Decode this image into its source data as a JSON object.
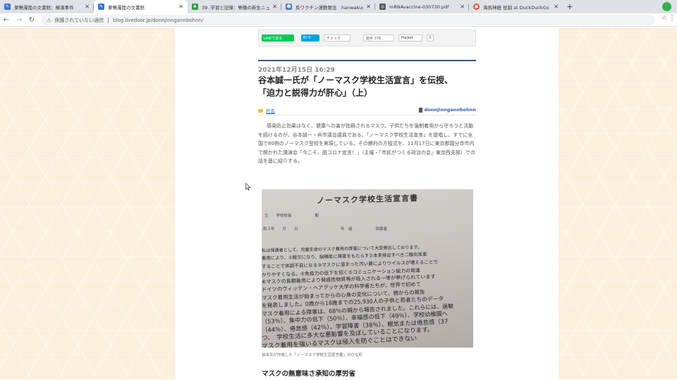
{
  "browser": {
    "tabs": [
      {
        "title": "巣鴨濁陸の文書館：横濱事件",
        "icon_color": "#3b6fd6",
        "active": false
      },
      {
        "title": "巣鴨濁陸の文書館",
        "icon_color": "#3b6fd6",
        "active": true
      },
      {
        "title": "39. 学習と記憶：脊髄の新生ニュー",
        "icon_color": "#2f9e44",
        "active": false
      },
      {
        "title": "反ワクチン運動要念　hanwakuchi",
        "icon_color": "#4a7bd0",
        "active": false
      },
      {
        "title": "mRNAvaccine-030730.pdf",
        "icon_color": "#555555",
        "active": false
      },
      {
        "title": "海馬神経 役割 at DuckDuckGo",
        "icon_color": "#de5833",
        "active": false
      }
    ],
    "new_tab_label": "+",
    "security_label": "保護されていない通信",
    "url": "blog.livedoor.jp/donnjinngannbohnn/"
  },
  "share": {
    "line": "LINEで送る",
    "hatena": "B! 0",
    "check": "チェック",
    "clap": "拍手 376",
    "pocket": "Pocket",
    "pocket_count": "0"
  },
  "post": {
    "date": "2021年12月15日 16:29",
    "title_line1": "谷本誠一氏が「ノーマスク学校生活宣言」を伝授、",
    "title_line2": "「迫力と説得力が肝心」（上）",
    "category": "社会",
    "author": "donnjinngannbohnn",
    "body": "感染防止効果はなく、健康への害が指摘されるマスク。子供たちを強制着用から守ろうと活動を続けるのが、谷本誠一・呉市議会議員である。「ノーマスク学校生活宣言」を提唱し、すでに全国で80例のノーマスク登校を実現している。その勝利の方程式を、11月17日に東京都国分寺市内で開かれた講演会「今こそ、脱コロナ宣言！」（主催・「市民がつくる政治の会」東京西支部）での話を基に紹介する。",
    "caption": "谷本氏が作成した「ノーマスク学校生活宣言書」のひな形",
    "subheading": "マスクの無意味さ承知の厚労省"
  },
  "photo": {
    "title": "ノーマスク学校生活宣言書",
    "header_line1": "立　　学校校長　　　　　　殿",
    "header_line2": "和３年　　月　　日　　　　　　　　　　　年　組　　　　　　保護者",
    "rows": [
      "私は保護者として、児童生徒のマスク着用の弊害について大変懸念しております。",
      "着用により、①酸欠になり、脳機能に障害をもたらす②本来排出すべき二酸化炭素",
      "することで体調不良になる③マスクに溜まった汚い菌によりウイルスが増えることで",
      "かりやすくなる。④免疫力の低下を招く⑤コミュニケーション能力の発達",
      "⑥マスクの長期着用により発癌性物質等が吸入される一等が挙げられています",
      "ドイツのヴィッテン・ヘアデッケ大学の科学者たちが、世界で初めて",
      "マスク着用生活が始まってからの心身の変化について、親からの報告",
      "を発表しました。0歳から18歳までの25,930人の子供と若者たちのデータ",
      "マスク着用による障害は、68％の親から報告されました。これらには、過敏",
      "（53％）、集中力の低下（50％）、幸福感の低下（49％）、学校幼稚園へ",
      "（44％）、倦怠感（42％）、学習障害（38％）、眠気または倦怠感（37",
      "つ、　学校生活に多大な悪影響を及ぼしていることになります。",
      "マスク着用を強いるマスクは侵入を防ぐことはできない"
    ]
  }
}
